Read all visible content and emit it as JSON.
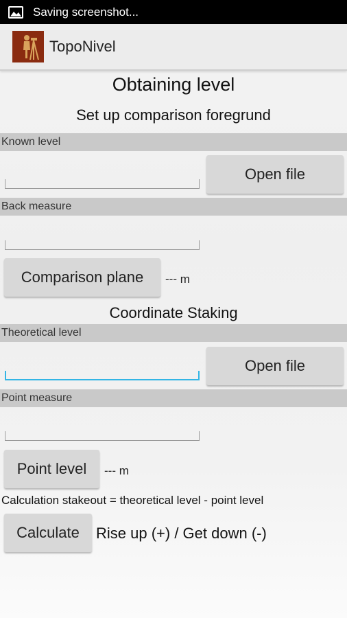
{
  "status_bar": {
    "text": "Saving screenshot..."
  },
  "app": {
    "title": "TopoNivel"
  },
  "headings": {
    "obtaining_level": "Obtaining level",
    "setup": "Set up comparison foregrund",
    "coordinate_staking": "Coordinate Staking"
  },
  "known_level": {
    "label": "Known level",
    "value": "",
    "open_file": "Open file"
  },
  "back_measure": {
    "label": "Back measure",
    "value": ""
  },
  "comparison_plane": {
    "button": "Comparison plane",
    "result": "--- m"
  },
  "theoretical_level": {
    "label": "Theoretical level",
    "value": "",
    "open_file": "Open file"
  },
  "point_measure": {
    "label": "Point measure",
    "value": ""
  },
  "point_level": {
    "button": "Point level",
    "result": "--- m"
  },
  "calculation": {
    "note": "Calculation stakeout = theoretical level - point level",
    "button": "Calculate",
    "result": "Rise up (+) / Get down (-)"
  },
  "colors": {
    "focus": "#33b5e5",
    "logo_bg": "#8a2b10"
  }
}
